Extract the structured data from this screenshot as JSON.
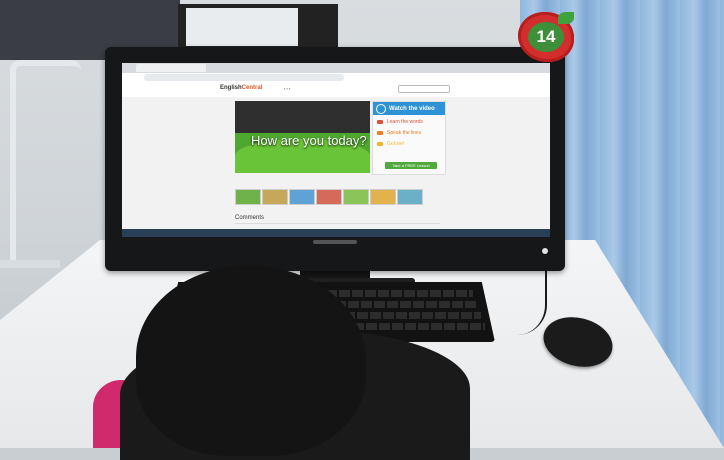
{
  "sticker": {
    "number": "14"
  },
  "screen": {
    "site": {
      "logo_main": "English",
      "logo_accent": "Central"
    },
    "video": {
      "title": "How are you today?"
    },
    "side_panel": {
      "watch_label": "Watch the video",
      "items": [
        {
          "label": "Learn the words",
          "color": "#e0513b"
        },
        {
          "label": "Speak the lines",
          "color": "#f07d24"
        },
        {
          "label": "GoLive!",
          "color": "#f3b529"
        }
      ],
      "cta": "Take a FREE Lesson"
    },
    "comments_title": "Comments"
  },
  "colors": {
    "watch_blue": "#2d93d6",
    "cta_green": "#4fa93c",
    "video_green": "#4ea82f",
    "sticker_red": "#d22e2e",
    "sticker_green": "#3d8f3a"
  }
}
